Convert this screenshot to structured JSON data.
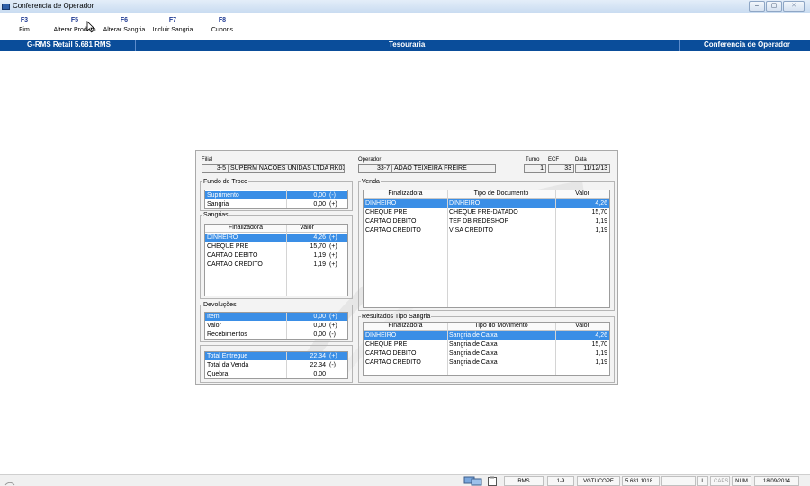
{
  "window": {
    "title": "Conferencia de Operador",
    "min": "–",
    "max": "▢",
    "close": "✕"
  },
  "toolbar": [
    {
      "key": "F3",
      "label": "Fim"
    },
    {
      "key": "F5",
      "label": "Alterar Produto"
    },
    {
      "key": "F6",
      "label": "Alterar Sangria"
    },
    {
      "key": "F7",
      "label": "Incluir Sangria"
    },
    {
      "key": "F8",
      "label": "Cupons"
    }
  ],
  "header": {
    "app": "G-RMS Retail 5.681 RMS",
    "module": "Tesouraria",
    "screen": "Conferencia de Operador"
  },
  "info": {
    "filial_label": "Filial",
    "filial_code": "3-5",
    "filial_name": "SUPERM NACOES UNIDAS LTDA RK03",
    "operador_label": "Operador",
    "operador_code": "33-7",
    "operador_name": "ADAO TEIXEIRA FREIRE",
    "turno_label": "Turno",
    "turno": "1",
    "ecf_label": "ECF",
    "ecf": "33",
    "data_label": "Data",
    "data": "11/12/13"
  },
  "fundo_troco": {
    "title": "Fundo de Troco",
    "rows": [
      {
        "label": "Suprimento",
        "value": "0,00",
        "sign": "(-)"
      },
      {
        "label": "Sangria",
        "value": "0,00",
        "sign": "(+)"
      }
    ]
  },
  "sangrias": {
    "title": "Sangrias",
    "columns": [
      "Finalizadora",
      "Valor"
    ],
    "rows": [
      {
        "fin": "DINHEIRO",
        "valor": "4,26",
        "sign": "(+)"
      },
      {
        "fin": "CHEQUE PRE",
        "valor": "15,70",
        "sign": "(+)"
      },
      {
        "fin": "CARTAO DEBITO",
        "valor": "1,19",
        "sign": "(+)"
      },
      {
        "fin": "CARTAO CREDITO",
        "valor": "1,19",
        "sign": "(+)"
      }
    ]
  },
  "devolucoes": {
    "title": "Devoluções",
    "rows": [
      {
        "label": "Item",
        "value": "0,00",
        "sign": "(+)"
      },
      {
        "label": "Valor",
        "value": "0,00",
        "sign": "(+)"
      },
      {
        "label": "Recebimentos",
        "value": "0,00",
        "sign": "(-)"
      }
    ]
  },
  "totais": {
    "rows": [
      {
        "label": "Total Entregue",
        "value": "22,34",
        "sign": "(+)"
      },
      {
        "label": "Total da Venda",
        "value": "22,34",
        "sign": "(-)"
      },
      {
        "label": "Quebra",
        "value": "0,00",
        "sign": ""
      }
    ]
  },
  "venda": {
    "title": "Venda",
    "columns": [
      "Finalizadora",
      "Tipo de Documento",
      "Valor"
    ],
    "rows": [
      {
        "fin": "DINHEIRO",
        "tipo": "DINHEIRO",
        "valor": "4,26"
      },
      {
        "fin": "CHEQUE PRE",
        "tipo": "CHEQUE PRE-DATADO",
        "valor": "15,70"
      },
      {
        "fin": "CARTAO DEBITO",
        "tipo": "TEF DB REDESHOP",
        "valor": "1,19"
      },
      {
        "fin": "CARTAO CREDITO",
        "tipo": "VISA CREDITO",
        "valor": "1,19"
      }
    ]
  },
  "resultados": {
    "title": "Resultados Tipo Sangria",
    "columns": [
      "Finalizadora",
      "Tipo do Movimento",
      "Valor"
    ],
    "rows": [
      {
        "fin": "DINHEIRO",
        "tipo": "Sangria de Caixa",
        "valor": "4,26"
      },
      {
        "fin": "CHEQUE PRE",
        "tipo": "Sangria de Caixa",
        "valor": "15,70"
      },
      {
        "fin": "CARTAO DEBITO",
        "tipo": "Sangria de Caixa",
        "valor": "1,19"
      },
      {
        "fin": "CARTAO CREDITO",
        "tipo": "Sangria de Caixa",
        "valor": "1,19"
      }
    ]
  },
  "statusbar": [
    "RMS",
    "1-9",
    "VGTUCOPE",
    "5.681.1018",
    "",
    "L",
    "CAPS",
    "NUM",
    "18/09/2014"
  ],
  "colors": {
    "band": "#0a4d9a",
    "selection": "#3a8ee6",
    "key": "#1f3a93"
  }
}
